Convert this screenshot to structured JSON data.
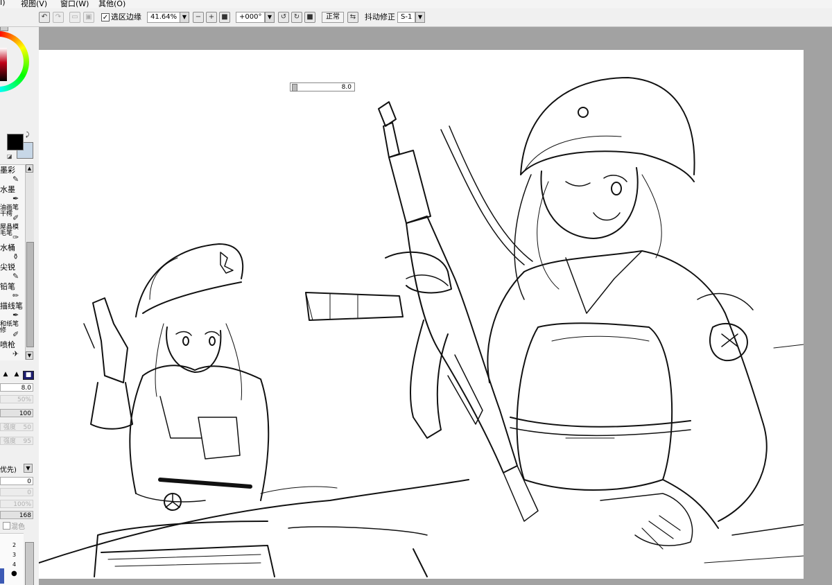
{
  "menu": {
    "partial_left": "I)",
    "view": "视图(V)",
    "window": "窗口(W)",
    "other": "其他(O)"
  },
  "toolbar": {
    "selection_edge_label": "选区边缘",
    "selection_edge_checked": true,
    "zoom_value": "41.64%",
    "rotation_value": "+000°",
    "normal_label": "正常",
    "stabilizer_label": "抖动修正",
    "stabilizer_value": "S-1"
  },
  "tools": [
    {
      "label": "墨彩"
    },
    {
      "label": "水墨"
    },
    {
      "label": "油画笔\n干樗"
    },
    {
      "label": "屋晶模\n毛笔"
    },
    {
      "label": "水桶"
    },
    {
      "label": "尖锐"
    },
    {
      "label": "铅笔"
    },
    {
      "label": "描线笔"
    },
    {
      "label": "和纸笔\n修"
    },
    {
      "label": "喷枪"
    }
  ],
  "brush": {
    "size": "8.0",
    "min_size": "50%",
    "density": "100",
    "blend_label": "强度",
    "blend_value": "50",
    "dilution_label": "强度",
    "dilution_value": "95",
    "priority_label": "优先)",
    "value_a": "0",
    "value_b": "0",
    "value_c": "100%",
    "value_d": "168",
    "mix_label": "混色",
    "list_numbers": [
      "2",
      "3",
      "4"
    ]
  },
  "canvas": {
    "brush_size_chip": "8.0"
  },
  "colors": {
    "foreground": "#000000",
    "background": "#c7d7e7",
    "canvas_bg": "#a2a2a2",
    "paper": "#ffffff"
  }
}
